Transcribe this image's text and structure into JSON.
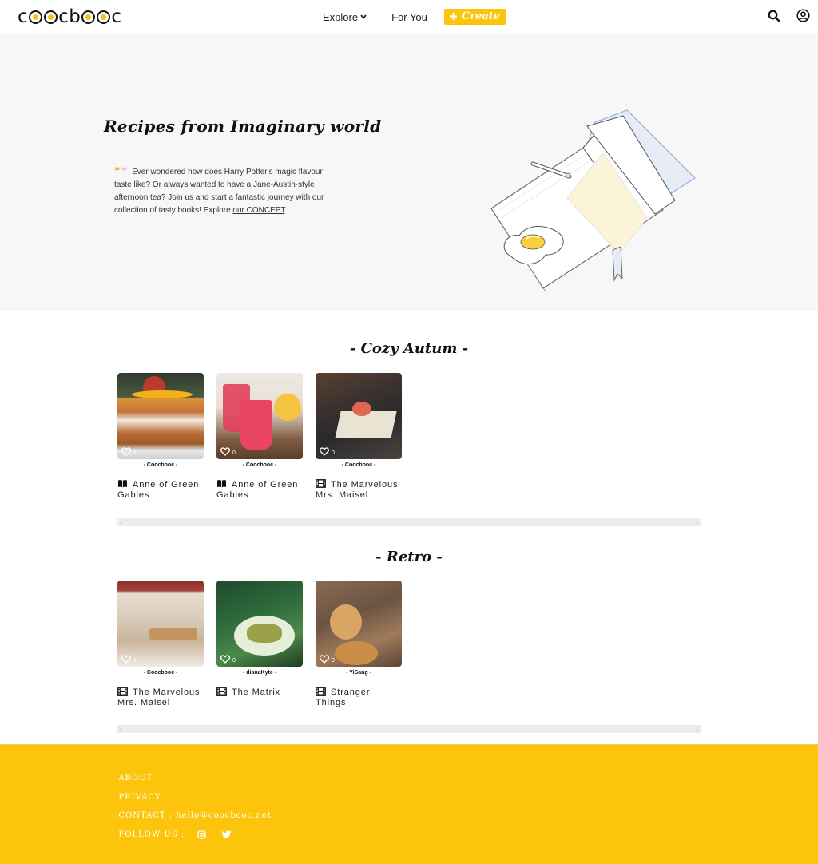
{
  "header": {
    "logo": "coocbooc",
    "nav": {
      "explore": "Explore",
      "for_you": "For You",
      "create": "Create"
    }
  },
  "hero": {
    "title": "Recipes from Imaginary world",
    "quote": "Ever wondered how does Harry Potter's magic flavour taste like? Or always wanted to have a Jane-Austin-style afternoon tea? Join us and start a fantastic journey with our collection of tasty books! Explore ",
    "link": "our CONCEPT",
    "quote_end": "."
  },
  "sections": [
    {
      "title": "- Cozy Autum -",
      "cards": [
        {
          "likes": "1",
          "author": "- Coocbooc -",
          "title": "Anne of Green Gables",
          "icon": "book-icon"
        },
        {
          "likes": "0",
          "author": "- Coocbooc -",
          "title": "Anne of Green Gables",
          "icon": "book-icon"
        },
        {
          "likes": "0",
          "author": "- Coocbooc -",
          "title": "The Marvelous Mrs. Maisel",
          "icon": "film-icon"
        }
      ]
    },
    {
      "title": "- Retro -",
      "cards": [
        {
          "likes": "1",
          "author": "- Coocbooc -",
          "title": "The Marvelous Mrs. Maisel",
          "icon": "film-icon"
        },
        {
          "likes": "0",
          "author": "- dianaKyte -",
          "title": "The Matrix",
          "icon": "film-icon"
        },
        {
          "likes": "0",
          "author": "- YiSang -",
          "title": "Stranger Things",
          "icon": "film-icon"
        }
      ]
    }
  ],
  "footer": {
    "about": "ABOUT",
    "privacy": "PRIVACY",
    "contact_label": "CONTACT :",
    "contact_email": "hello@coocbooc.net",
    "follow_label": "FOLLOW US :",
    "separator": "|"
  },
  "colors": {
    "accent": "#fdc40c",
    "hero_bg": "#f7f7f7"
  }
}
